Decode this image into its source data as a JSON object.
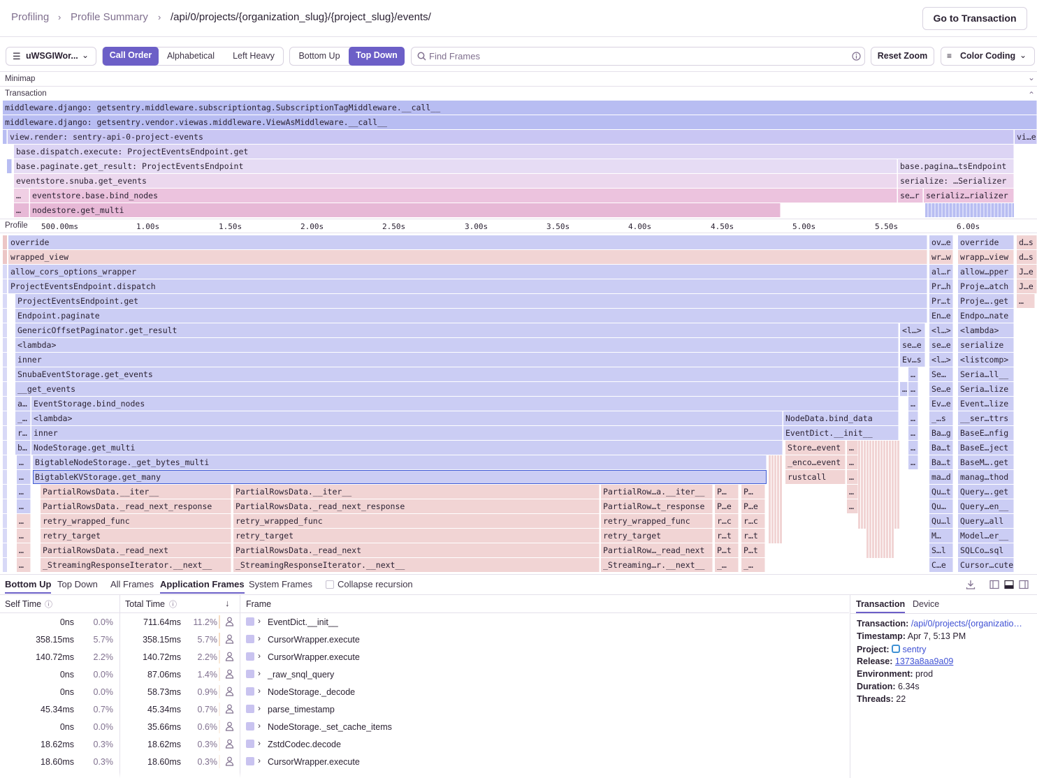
{
  "breadcrumbs": [
    "Profiling",
    "Profile Summary",
    "/api/0/projects/{organization_slug}/{project_slug}/events/"
  ],
  "goto_button": "Go to Transaction",
  "thread_select": "uWSGIWor...",
  "view_buttons": [
    "Call Order",
    "Alphabetical",
    "Left Heavy"
  ],
  "direction_buttons": [
    "Bottom Up",
    "Top Down"
  ],
  "search_placeholder": "Find Frames",
  "reset_zoom": "Reset Zoom",
  "color_coding": "Color Coding",
  "minimap_label": "Minimap",
  "transaction_label": "Transaction",
  "profile_label": "Profile",
  "timeline_ticks": [
    "500.00ms",
    "1.00s",
    "1.50s",
    "2.00s",
    "2.50s",
    "3.00s",
    "3.50s",
    "4.00s",
    "4.50s",
    "5.00s",
    "5.50s",
    "6.00s"
  ],
  "transaction_spans": [
    [
      "middleware.django: getsentry.middleware.subscriptiontag.SubscriptionTagMiddleware.__call__"
    ],
    [
      "middleware.django: getsentry.vendor.viewas.middleware.ViewAsMiddleware.__call__"
    ],
    [
      "view.render: sentry-api-0-project-events",
      "vi…e"
    ],
    [
      "base.dispatch.execute: ProjectEventsEndpoint.get"
    ],
    [
      "base.paginate.get_result: ProjectEventsEndpoint",
      "base.pagina…tsEndpoint"
    ],
    [
      "eventstore.snuba.get_events",
      "serialize: …Serializer"
    ],
    [
      "…",
      "eventstore.base.bind_nodes",
      "se…r",
      "serializ…rializer"
    ],
    [
      "…",
      "nodestore.get_multi"
    ]
  ],
  "profile_rows": [
    [
      "override",
      "ov…e",
      "override",
      "d…s"
    ],
    [
      "wrapped_view",
      "wr…w",
      "wrapp…view",
      "d…s"
    ],
    [
      "allow_cors_options_wrapper",
      "al…r",
      "allow…pper",
      "J…e"
    ],
    [
      "ProjectEventsEndpoint.dispatch",
      "Pr…h",
      "Proje…atch",
      "J…e"
    ],
    [
      "ProjectEventsEndpoint.get",
      "Pr…t",
      "Proje….get",
      "…"
    ],
    [
      "Endpoint.paginate",
      "En…e",
      "Endpo…nate"
    ],
    [
      "GenericOffsetPaginator.get_result",
      "<l…>",
      "<l…>",
      "<lambda>"
    ],
    [
      "<lambda>",
      "se…e",
      "se…e",
      "serialize"
    ],
    [
      "inner",
      "Ev…s",
      "<l…>",
      "<listcomp>"
    ],
    [
      "SnubaEventStorage.get_events",
      "…",
      "Se…",
      "Seria…ll__"
    ],
    [
      "__get_events",
      "…",
      "…",
      "Se…e",
      "Seria…lize"
    ],
    [
      "a…",
      "EventStorage.bind_nodes",
      "…",
      "Ev…e",
      "Event…lize"
    ],
    [
      "_…",
      "<lambda>",
      "NodeData.bind_data",
      "…",
      "_…s",
      "__ser…ttrs"
    ],
    [
      "r…",
      "inner",
      "EventDict.__init__",
      "…",
      "Ba…g",
      "BaseE…nfig"
    ],
    [
      "b…",
      "NodeStorage.get_multi",
      "Store…event",
      "…",
      "…",
      "Ba…t",
      "BaseE…ject"
    ],
    [
      "…",
      "BigtableNodeStorage._get_bytes_multi",
      "_enco…event",
      "…",
      "…",
      "Ba…t",
      "BaseM….get"
    ],
    [
      "…",
      "BigtableKVStorage.get_many",
      "rustcall",
      "…",
      "ma…d",
      "manag…thod"
    ],
    [
      "…",
      "PartialRowsData.__iter__",
      "PartialRowsData.__iter__",
      "PartialRow…a.__iter__",
      "P…",
      "P…",
      "…",
      "Qu…t",
      "Query….get"
    ],
    [
      "…",
      "PartialRowsData._read_next_response",
      "PartialRowsData._read_next_response",
      "PartialRow…t_response",
      "P…e",
      "P…e",
      "…",
      "Qu…",
      "Query…en__"
    ],
    [
      "…",
      "retry_wrapped_func",
      "retry_wrapped_func",
      "retry_wrapped_func",
      "r…c",
      "r…c",
      "Qu…l",
      "Query…all"
    ],
    [
      "…",
      "retry_target",
      "retry_target",
      "retry_target",
      "r…t",
      "r…t",
      "M…",
      "Model…er__"
    ],
    [
      "…",
      "PartialRowsData._read_next",
      "PartialRowsData._read_next",
      "PartialRow…_read_next",
      "P…t",
      "P…t",
      "S…l",
      "SQLCo…sql"
    ],
    [
      "…",
      "_StreamingResponseIterator.__next__",
      "_StreamingResponseIterator.__next__",
      "_Streaming…r.__next__",
      "_…",
      "_…",
      "C…e",
      "Cursor…cute"
    ]
  ],
  "bottom_tabs": [
    "Bottom Up",
    "Top Down",
    "All Frames",
    "Application Frames",
    "System Frames"
  ],
  "collapse_recursion": "Collapse recursion",
  "table_headers": {
    "self_time": "Self Time",
    "total_time": "Total Time",
    "frame": "Frame"
  },
  "table_rows": [
    {
      "self": "0ns",
      "self_pct": "0.0%",
      "total": "711.64ms",
      "total_pct": "11.2%",
      "frame": "EventDict.__init__"
    },
    {
      "self": "358.15ms",
      "self_pct": "5.7%",
      "total": "358.15ms",
      "total_pct": "5.7%",
      "frame": "CursorWrapper.execute"
    },
    {
      "self": "140.72ms",
      "self_pct": "2.2%",
      "total": "140.72ms",
      "total_pct": "2.2%",
      "frame": "CursorWrapper.execute"
    },
    {
      "self": "0ns",
      "self_pct": "0.0%",
      "total": "87.06ms",
      "total_pct": "1.4%",
      "frame": "_raw_snql_query"
    },
    {
      "self": "0ns",
      "self_pct": "0.0%",
      "total": "58.73ms",
      "total_pct": "0.9%",
      "frame": "NodeStorage._decode"
    },
    {
      "self": "45.34ms",
      "self_pct": "0.7%",
      "total": "45.34ms",
      "total_pct": "0.7%",
      "frame": "parse_timestamp"
    },
    {
      "self": "0ns",
      "self_pct": "0.0%",
      "total": "35.66ms",
      "total_pct": "0.6%",
      "frame": "NodeStorage._set_cache_items"
    },
    {
      "self": "18.62ms",
      "self_pct": "0.3%",
      "total": "18.62ms",
      "total_pct": "0.3%",
      "frame": "ZstdCodec.decode"
    },
    {
      "self": "18.60ms",
      "self_pct": "0.3%",
      "total": "18.60ms",
      "total_pct": "0.3%",
      "frame": "CursorWrapper.execute"
    }
  ],
  "detail_tabs": [
    "Transaction",
    "Device"
  ],
  "details": {
    "transaction_label": "Transaction:",
    "transaction_value": "/api/0/projects/{organizatio…",
    "timestamp_label": "Timestamp:",
    "timestamp_value": "Apr 7, 5:13 PM",
    "project_label": "Project:",
    "project_value": "sentry",
    "release_label": "Release:",
    "release_value": "1373a8aa9a09",
    "environment_label": "Environment:",
    "environment_value": "prod",
    "duration_label": "Duration:",
    "duration_value": "6.34s",
    "threads_label": "Threads:",
    "threads_value": "22"
  },
  "colors": {
    "accent": "#6c5fc7",
    "span_blue": "#b8bdf2",
    "span_lavender": "#ddd3f5",
    "span_pink": "#f0cfe4",
    "span_rose": "#e7b8d6",
    "frame_blue": "#cbcdf4",
    "frame_pink": "#f1d4d4"
  }
}
